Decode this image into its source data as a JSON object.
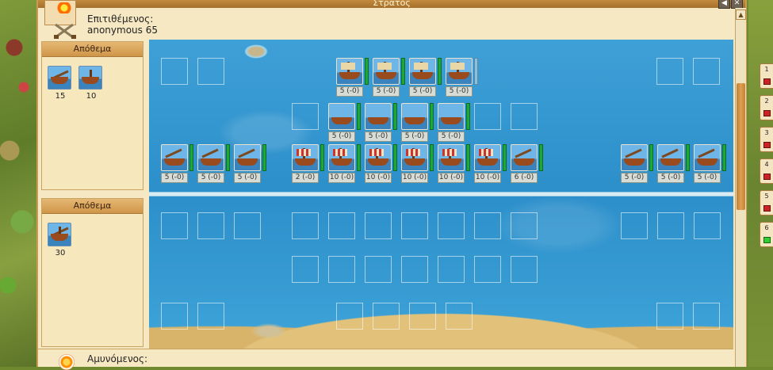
{
  "window": {
    "title": "Στρατός",
    "btn_back": "◀",
    "btn_close": "✕"
  },
  "scroll": {
    "up": "▲"
  },
  "attacker": {
    "label": "Επιτιθέμενος:",
    "name": "anonymous 65"
  },
  "defender": {
    "label": "Αμυνόμενος:"
  },
  "stock_top": {
    "title": "Απόθεμα",
    "units": [
      {
        "icon": "catapult-ship-icon",
        "count": "15"
      },
      {
        "icon": "galley-icon",
        "count": "10"
      }
    ]
  },
  "stock_bottom": {
    "title": "Απόθεμα",
    "units": [
      {
        "icon": "trireme-icon",
        "count": "30"
      }
    ]
  },
  "attack_units": {
    "row1": [
      {
        "icon": "galley-icon",
        "label": "5 (-0)"
      },
      {
        "icon": "galley-icon",
        "label": "5 (-0)"
      },
      {
        "icon": "galley-icon",
        "label": "5 (-0)"
      },
      {
        "icon": "galley-icon",
        "label": "5 (-0)"
      }
    ],
    "row2": [
      {
        "icon": "boat-icon",
        "label": "5 (-0)"
      },
      {
        "icon": "boat-icon",
        "label": "5 (-0)"
      },
      {
        "icon": "boat-icon",
        "label": "5 (-0)"
      },
      {
        "icon": "boat-icon",
        "label": "5 (-0)"
      }
    ],
    "row3_left": [
      {
        "icon": "catapult-ship-icon",
        "label": "5 (-0)"
      },
      {
        "icon": "catapult-ship-icon",
        "label": "5 (-0)"
      },
      {
        "icon": "catapult-ship-icon",
        "label": "5 (-0)"
      }
    ],
    "row3_mid": [
      {
        "icon": "warship-icon",
        "label": "2 (-0)"
      },
      {
        "icon": "warship-icon",
        "label": "10 (-0)"
      },
      {
        "icon": "warship-icon",
        "label": "10 (-0)"
      },
      {
        "icon": "warship-icon",
        "label": "10 (-0)"
      },
      {
        "icon": "warship-icon",
        "label": "10 (-0)"
      },
      {
        "icon": "warship-icon",
        "label": "10 (-0)"
      },
      {
        "icon": "catapult-ship-icon",
        "label": "6 (-0)"
      }
    ],
    "row3_right": [
      {
        "icon": "catapult-ship-icon",
        "label": "5 (-0)"
      },
      {
        "icon": "catapult-ship-icon",
        "label": "5 (-0)"
      },
      {
        "icon": "catapult-ship-icon",
        "label": "5 (-0)"
      }
    ]
  },
  "side_tabs": [
    "1",
    "2",
    "3",
    "4",
    "5",
    "6"
  ],
  "colors": {
    "sea": "#2d8fca",
    "panel": "#f7e7bd",
    "health": "#1fa83a"
  }
}
